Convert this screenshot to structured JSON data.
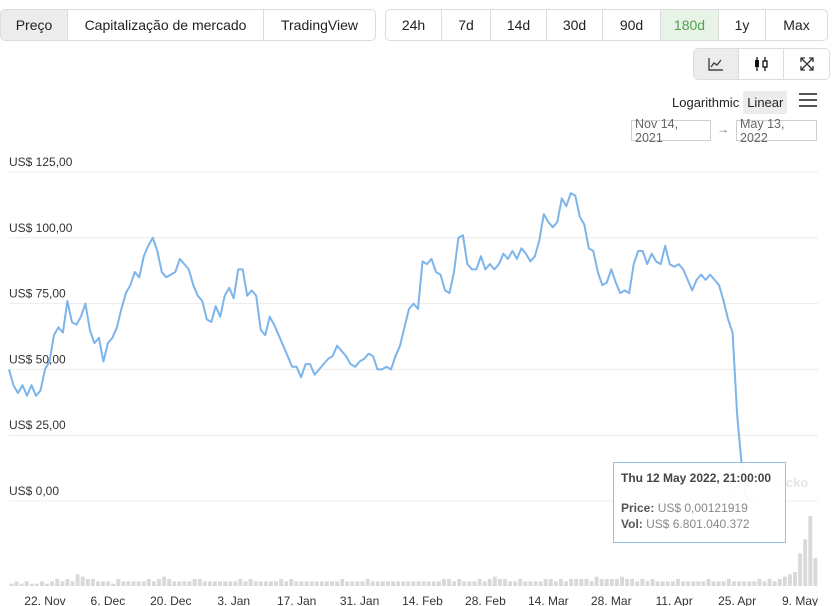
{
  "tabs": [
    {
      "label": "Preço",
      "active": true
    },
    {
      "label": "Capitalização de mercado",
      "active": false
    },
    {
      "label": "TradingView",
      "active": false
    }
  ],
  "ranges": [
    {
      "label": "24h",
      "active": false
    },
    {
      "label": "7d",
      "active": false
    },
    {
      "label": "14d",
      "active": false
    },
    {
      "label": "30d",
      "active": false
    },
    {
      "label": "90d",
      "active": false
    },
    {
      "label": "180d",
      "active": true
    },
    {
      "label": "1y",
      "active": false
    },
    {
      "label": "Max",
      "active": false
    }
  ],
  "chart_types": [
    {
      "icon": "line-chart-icon",
      "active": true
    },
    {
      "icon": "candlestick-icon",
      "active": false
    },
    {
      "icon": "fullscreen-icon",
      "active": false
    }
  ],
  "scale": {
    "logarithmic": "Logarithmic",
    "linear": "Linear",
    "active": "Linear"
  },
  "date_range": {
    "from": "Nov 14, 2021",
    "arrow": "→",
    "to": "May 13, 2022"
  },
  "tooltip": {
    "title": "Thu 12 May 2022, 21:00:00",
    "price_label": "Price:",
    "price_value": "US$ 0,00121919",
    "vol_label": "Vol:",
    "vol_value": "US$ 6.801.040.372"
  },
  "watermark": "coingecko",
  "colors": {
    "line": "#7cb5ec",
    "active_range": "#4da24d",
    "volume": "#d9d9d9"
  },
  "chart_data": {
    "type": "line",
    "x_start": "2021-11-14",
    "x_end": "2022-05-13",
    "ylim": [
      0,
      125
    ],
    "y_ticks": [
      0,
      25,
      50,
      75,
      100,
      125
    ],
    "y_tick_labels": [
      "US$ 0,00",
      "US$ 25,00",
      "US$ 50,00",
      "US$ 75,00",
      "US$ 100,00",
      "US$ 125,00"
    ],
    "x_ticks": [
      {
        "date": "2021-11-22",
        "label": "22. Nov"
      },
      {
        "date": "2021-12-06",
        "label": "6. Dec"
      },
      {
        "date": "2021-12-20",
        "label": "20. Dec"
      },
      {
        "date": "2022-01-03",
        "label": "3. Jan"
      },
      {
        "date": "2022-01-17",
        "label": "17. Jan"
      },
      {
        "date": "2022-01-31",
        "label": "31. Jan"
      },
      {
        "date": "2022-02-14",
        "label": "14. Feb"
      },
      {
        "date": "2022-02-28",
        "label": "28. Feb"
      },
      {
        "date": "2022-03-14",
        "label": "14. Mar"
      },
      {
        "date": "2022-03-28",
        "label": "28. Mar"
      },
      {
        "date": "2022-04-11",
        "label": "11. Apr"
      },
      {
        "date": "2022-04-25",
        "label": "25. Apr"
      },
      {
        "date": "2022-05-09",
        "label": "9. May"
      }
    ],
    "grid": true,
    "series": [
      {
        "name": "Price",
        "points": [
          [
            "2021-11-14",
            50
          ],
          [
            "2021-11-15",
            44
          ],
          [
            "2021-11-16",
            41
          ],
          [
            "2021-11-17",
            44
          ],
          [
            "2021-11-18",
            40
          ],
          [
            "2021-11-19",
            44
          ],
          [
            "2021-11-20",
            40
          ],
          [
            "2021-11-21",
            42
          ],
          [
            "2021-11-22",
            50
          ],
          [
            "2021-11-23",
            53
          ],
          [
            "2021-11-24",
            63
          ],
          [
            "2021-11-25",
            66
          ],
          [
            "2021-11-26",
            64
          ],
          [
            "2021-11-27",
            76
          ],
          [
            "2021-11-28",
            68
          ],
          [
            "2021-11-29",
            67
          ],
          [
            "2021-11-30",
            70
          ],
          [
            "2021-12-01",
            75
          ],
          [
            "2021-12-02",
            65
          ],
          [
            "2021-12-03",
            60
          ],
          [
            "2021-12-04",
            62
          ],
          [
            "2021-12-05",
            53
          ],
          [
            "2021-12-06",
            60
          ],
          [
            "2021-12-07",
            62
          ],
          [
            "2021-12-08",
            66
          ],
          [
            "2021-12-09",
            73
          ],
          [
            "2021-12-10",
            79
          ],
          [
            "2021-12-11",
            82
          ],
          [
            "2021-12-12",
            87
          ],
          [
            "2021-12-13",
            85
          ],
          [
            "2021-12-14",
            93
          ],
          [
            "2021-12-15",
            97
          ],
          [
            "2021-12-16",
            100
          ],
          [
            "2021-12-17",
            95
          ],
          [
            "2021-12-18",
            87
          ],
          [
            "2021-12-19",
            85
          ],
          [
            "2021-12-20",
            86
          ],
          [
            "2021-12-21",
            87
          ],
          [
            "2021-12-22",
            92
          ],
          [
            "2021-12-23",
            90
          ],
          [
            "2021-12-24",
            88
          ],
          [
            "2021-12-25",
            82
          ],
          [
            "2021-12-26",
            78
          ],
          [
            "2021-12-27",
            76
          ],
          [
            "2021-12-28",
            69
          ],
          [
            "2021-12-29",
            68
          ],
          [
            "2021-12-30",
            74
          ],
          [
            "2021-12-31",
            70
          ],
          [
            "2022-01-01",
            78
          ],
          [
            "2022-01-02",
            81
          ],
          [
            "2022-01-03",
            77
          ],
          [
            "2022-01-04",
            88
          ],
          [
            "2022-01-05",
            88
          ],
          [
            "2022-01-06",
            78
          ],
          [
            "2022-01-07",
            80
          ],
          [
            "2022-01-08",
            78
          ],
          [
            "2022-01-09",
            65
          ],
          [
            "2022-01-10",
            63
          ],
          [
            "2022-01-11",
            70
          ],
          [
            "2022-01-12",
            67
          ],
          [
            "2022-01-13",
            63
          ],
          [
            "2022-01-14",
            59
          ],
          [
            "2022-01-15",
            55
          ],
          [
            "2022-01-16",
            51
          ],
          [
            "2022-01-17",
            51
          ],
          [
            "2022-01-18",
            47
          ],
          [
            "2022-01-19",
            52
          ],
          [
            "2022-01-20",
            52
          ],
          [
            "2022-01-21",
            48
          ],
          [
            "2022-01-22",
            50
          ],
          [
            "2022-01-23",
            52
          ],
          [
            "2022-01-24",
            54
          ],
          [
            "2022-01-25",
            55
          ],
          [
            "2022-01-26",
            59
          ],
          [
            "2022-01-27",
            57
          ],
          [
            "2022-01-28",
            55
          ],
          [
            "2022-01-29",
            52
          ],
          [
            "2022-01-30",
            51
          ],
          [
            "2022-01-31",
            53
          ],
          [
            "2022-02-01",
            54
          ],
          [
            "2022-02-02",
            56
          ],
          [
            "2022-02-03",
            55
          ],
          [
            "2022-02-04",
            50
          ],
          [
            "2022-02-05",
            50
          ],
          [
            "2022-02-06",
            51
          ],
          [
            "2022-02-07",
            50
          ],
          [
            "2022-02-08",
            55
          ],
          [
            "2022-02-09",
            59
          ],
          [
            "2022-02-10",
            66
          ],
          [
            "2022-02-11",
            73
          ],
          [
            "2022-02-12",
            75
          ],
          [
            "2022-02-13",
            73
          ],
          [
            "2022-02-14",
            91
          ],
          [
            "2022-02-15",
            90
          ],
          [
            "2022-02-16",
            92
          ],
          [
            "2022-02-17",
            87
          ],
          [
            "2022-02-18",
            86
          ],
          [
            "2022-02-19",
            80
          ],
          [
            "2022-02-20",
            79
          ],
          [
            "2022-02-21",
            87
          ],
          [
            "2022-02-22",
            100
          ],
          [
            "2022-02-23",
            101
          ],
          [
            "2022-02-24",
            90
          ],
          [
            "2022-02-25",
            88
          ],
          [
            "2022-02-26",
            88
          ],
          [
            "2022-02-27",
            93
          ],
          [
            "2022-02-28",
            88
          ],
          [
            "2022-03-01",
            90
          ],
          [
            "2022-03-02",
            88
          ],
          [
            "2022-03-03",
            90
          ],
          [
            "2022-03-04",
            94
          ],
          [
            "2022-03-05",
            92
          ],
          [
            "2022-03-06",
            95
          ],
          [
            "2022-03-07",
            92
          ],
          [
            "2022-03-08",
            96
          ],
          [
            "2022-03-09",
            94
          ],
          [
            "2022-03-10",
            91
          ],
          [
            "2022-03-11",
            93
          ],
          [
            "2022-03-12",
            99
          ],
          [
            "2022-03-13",
            109
          ],
          [
            "2022-03-14",
            106
          ],
          [
            "2022-03-15",
            104
          ],
          [
            "2022-03-16",
            106
          ],
          [
            "2022-03-17",
            115
          ],
          [
            "2022-03-18",
            112
          ],
          [
            "2022-03-19",
            117
          ],
          [
            "2022-03-20",
            116
          ],
          [
            "2022-03-21",
            108
          ],
          [
            "2022-03-22",
            105
          ],
          [
            "2022-03-23",
            96
          ],
          [
            "2022-03-24",
            95
          ],
          [
            "2022-03-25",
            87
          ],
          [
            "2022-03-26",
            82
          ],
          [
            "2022-03-27",
            83
          ],
          [
            "2022-03-28",
            88
          ],
          [
            "2022-03-29",
            83
          ],
          [
            "2022-03-30",
            79
          ],
          [
            "2022-03-31",
            80
          ],
          [
            "2022-04-01",
            79
          ],
          [
            "2022-04-02",
            90
          ],
          [
            "2022-04-03",
            95
          ],
          [
            "2022-04-04",
            95
          ],
          [
            "2022-04-05",
            90
          ],
          [
            "2022-04-06",
            94
          ],
          [
            "2022-04-07",
            91
          ],
          [
            "2022-04-08",
            90
          ],
          [
            "2022-04-09",
            97
          ],
          [
            "2022-04-10",
            90
          ],
          [
            "2022-04-11",
            89
          ],
          [
            "2022-04-12",
            90
          ],
          [
            "2022-04-13",
            88
          ],
          [
            "2022-04-14",
            84
          ],
          [
            "2022-04-15",
            80
          ],
          [
            "2022-04-16",
            84
          ],
          [
            "2022-04-17",
            86
          ],
          [
            "2022-04-18",
            84
          ],
          [
            "2022-04-19",
            86
          ],
          [
            "2022-04-20",
            84
          ],
          [
            "2022-04-21",
            82
          ],
          [
            "2022-04-22",
            76
          ],
          [
            "2022-04-23",
            69
          ],
          [
            "2022-04-24",
            64
          ],
          [
            "2022-04-25",
            33
          ],
          [
            "2022-04-26",
            14
          ],
          [
            "2022-04-27",
            2
          ],
          [
            "2022-04-28",
            0.1
          ],
          [
            "2022-04-29",
            0.001
          ]
        ]
      }
    ],
    "volume_relative": [
      1,
      2,
      1,
      2,
      1,
      1,
      2,
      1,
      2,
      3,
      2,
      3,
      2,
      5,
      4,
      3,
      3,
      2,
      2,
      2,
      1,
      3,
      2,
      2,
      2,
      2,
      2,
      3,
      2,
      3,
      4,
      3,
      2,
      2,
      2,
      2,
      3,
      3,
      2,
      2,
      2,
      2,
      2,
      2,
      2,
      3,
      2,
      3,
      2,
      2,
      2,
      2,
      2,
      3,
      2,
      3,
      2,
      2,
      2,
      2,
      2,
      2,
      2,
      2,
      2,
      3,
      2,
      2,
      2,
      2,
      3,
      2,
      2,
      2,
      2,
      2,
      2,
      2,
      2,
      2,
      2,
      2,
      2,
      2,
      2,
      3,
      3,
      2,
      3,
      2,
      2,
      2,
      3,
      2,
      3,
      4,
      3,
      3,
      2,
      2,
      3,
      2,
      2,
      2,
      2,
      3,
      3,
      2,
      3,
      2,
      3,
      3,
      3,
      3,
      2,
      4,
      3,
      3,
      3,
      3,
      4,
      3,
      3,
      2,
      3,
      2,
      3,
      2,
      2,
      2,
      2,
      3,
      2,
      2,
      2,
      2,
      2,
      3,
      2,
      2,
      2,
      3,
      2,
      2,
      2,
      2,
      2,
      3,
      2,
      3,
      2,
      3,
      4,
      5,
      6,
      14,
      20,
      30,
      12
    ]
  }
}
